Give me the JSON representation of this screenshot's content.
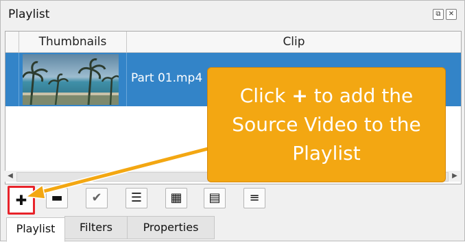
{
  "window": {
    "title": "Playlist",
    "restore_glyph": "⧉",
    "close_glyph": "✕"
  },
  "table": {
    "columns": [
      "Thumbnails",
      "Clip"
    ],
    "rows": [
      {
        "clip": "Part 01.mp4",
        "selected": true
      }
    ]
  },
  "scrollbar": {
    "left_glyph": "◀",
    "right_glyph": "▶"
  },
  "toolbar": {
    "buttons": [
      {
        "name": "add-button",
        "icon": "plus-icon",
        "glyph": "✚",
        "highlighted": true
      },
      {
        "name": "remove-button",
        "icon": "minus-icon",
        "glyph": "▬"
      },
      {
        "name": "update-button",
        "icon": "checkmark-icon",
        "glyph": "✔"
      },
      {
        "name": "details-view-button",
        "icon": "list-icon",
        "glyph": "☰"
      },
      {
        "name": "tiles-view-button",
        "icon": "grid-icon",
        "glyph": "▦"
      },
      {
        "name": "icons-view-button",
        "icon": "table-icon",
        "glyph": "▤"
      },
      {
        "name": "menu-button",
        "icon": "menu-icon",
        "glyph": "≡"
      }
    ]
  },
  "tabs": [
    {
      "label": "Playlist",
      "active": true
    },
    {
      "label": "Filters",
      "active": false
    },
    {
      "label": "Properties",
      "active": false
    }
  ],
  "callout": {
    "lines": [
      "Click + to add the",
      "Source Video to the",
      "Playlist"
    ],
    "color": "#f3a712"
  },
  "colors": {
    "selection": "#3384c8",
    "highlight": "#e8232a"
  }
}
